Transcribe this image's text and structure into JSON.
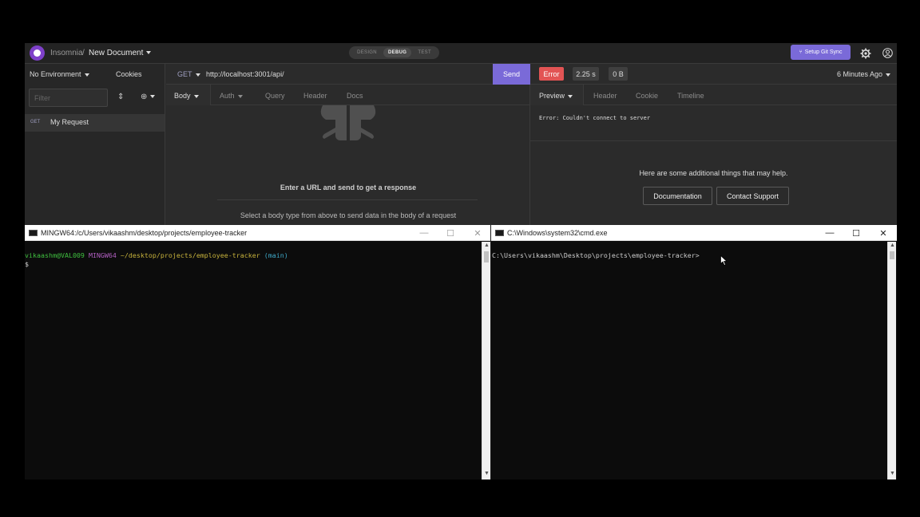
{
  "insomnia": {
    "app_name": "Insomnia",
    "separator": "/",
    "document": "New Document",
    "modes": [
      "DESIGN",
      "DEBUG",
      "TEST"
    ],
    "active_mode": "DEBUG",
    "git_sync": "Setup Git Sync",
    "sidebar": {
      "environment": "No Environment",
      "cookies": "Cookies",
      "filter_placeholder": "Filter",
      "request_method": "GET",
      "request_name": "My Request"
    },
    "request": {
      "method": "GET",
      "url": "http://localhost:3001/api/",
      "send": "Send",
      "tabs": [
        "Body",
        "Auth",
        "Query",
        "Header",
        "Docs"
      ],
      "hint_main": "Enter a URL and send to get a response",
      "hint_body": "Select a body type from above to send data in the body of a request"
    },
    "response": {
      "status": "Error",
      "time": "2.25 s",
      "size": "0 B",
      "ago": "6 Minutes Ago",
      "tabs": [
        "Preview",
        "Header",
        "Cookie",
        "Timeline"
      ],
      "error_message": "Error: Couldn't connect to server",
      "help_text": "Here are some additional things that may help.",
      "documentation": "Documentation",
      "contact_support": "Contact Support"
    },
    "colors": {
      "accent": "#7a6ad8",
      "error": "#e25454",
      "logo": "#7e40c9"
    }
  },
  "mingw": {
    "title": "MINGW64:/c/Users/vikaashm/desktop/projects/employee-tracker",
    "prompt_user": "vikaashm@VAL009",
    "prompt_shell": "MINGW64",
    "prompt_path": "~/desktop/projects/employee-tracker",
    "prompt_branch": "(main)",
    "prompt_symbol": "$"
  },
  "cmd": {
    "title": "C:\\Windows\\system32\\cmd.exe",
    "prompt": "C:\\Users\\vikaashm\\Desktop\\projects\\employee-tracker>"
  }
}
